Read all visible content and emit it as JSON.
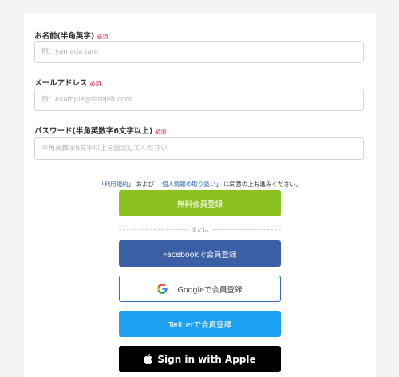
{
  "form": {
    "name_label": "お名前(半角英字)",
    "name_placeholder": "例：yamada taro",
    "email_label": "メールアドレス",
    "email_placeholder": "例：example@rarejob.com",
    "password_label": "パスワード(半角英数字6文字以上)",
    "password_placeholder": "半角英数字6文字以上を設定してください",
    "required_badge": "必須"
  },
  "terms": {
    "open_bracket_1": "「",
    "terms_link": "利用規約",
    "close_bracket_1": "」",
    "and_text": " および ",
    "open_bracket_2": "「",
    "privacy_link": "個人情報の取り扱い",
    "close_bracket_2": "」",
    "agree_text": " に同意の上お進みください。"
  },
  "buttons": {
    "free_register": "無料会員登録",
    "divider_text": "または",
    "facebook": "Facebookで会員登録",
    "google": "Googleで会員登録",
    "twitter": "Twitterで会員登録",
    "apple": "Sign in with Apple"
  },
  "colors": {
    "required": "#e60033",
    "free_button": "#8cc220",
    "facebook": "#3b5fa5",
    "google_border": "#3b6cc9",
    "twitter": "#1da1f2",
    "apple": "#000000",
    "link": "#2d6cb5"
  },
  "icons": {
    "google": "google-g-icon",
    "apple": "apple-logo-icon"
  }
}
